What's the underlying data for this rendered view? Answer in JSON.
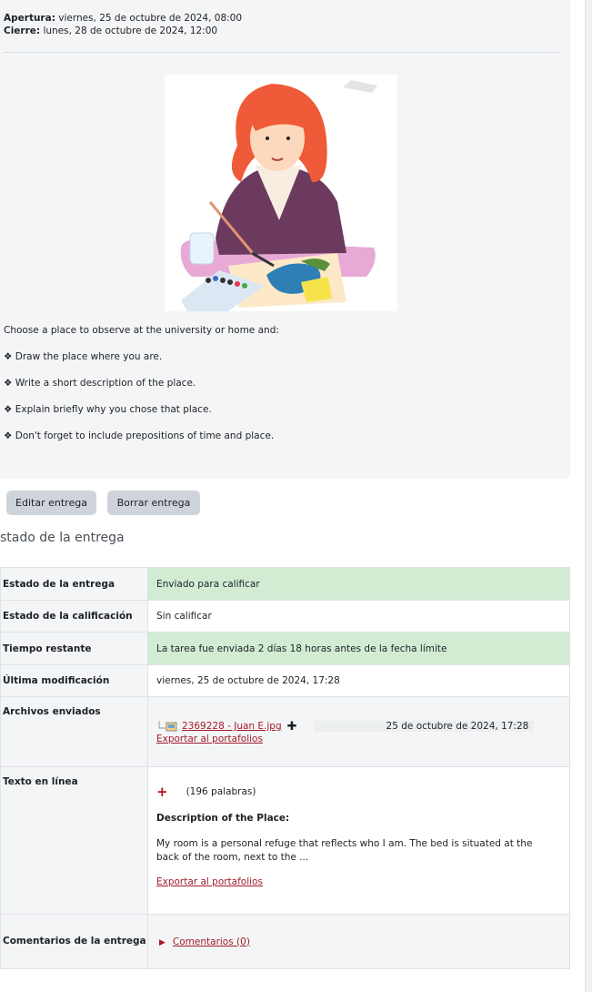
{
  "dates": {
    "opening_label": "Apertura:",
    "opening_value": "viernes, 25 de octubre de 2024, 08:00",
    "closing_label": "Cierre:",
    "closing_value": "lunes, 28 de octubre de 2024, 12:00"
  },
  "instructions": {
    "intro": "Choose a place to observe at the university or home and:",
    "items": [
      "❖ Draw the place where you are.",
      "❖ Write a short description of the place.",
      "❖ Explain briefly why you chose that place.",
      "❖ Don't forget to include prepositions of time and place."
    ]
  },
  "actions": {
    "edit_label": "Editar entrega",
    "delete_label": "Borrar entrega"
  },
  "submission": {
    "section_title": "stado de la entrega",
    "rows": {
      "status_label": "Estado de la entrega",
      "status_value": "Enviado para calificar",
      "grading_label": "Estado de la calificación",
      "grading_value": "Sin calificar",
      "time_label": "Tiempo restante",
      "time_value": "La tarea fue enviada 2 días 18 horas antes de la fecha límite",
      "modified_label": "Última modificación",
      "modified_value": "viernes, 25 de octubre de 2024, 17:28",
      "files_label": "Archivos enviados",
      "file_name": "2369228 - Juan E.jpg",
      "file_date": "25 de octubre de 2024, 17:28",
      "files_export": "Exportar al portafolios",
      "online_label": "Texto en línea",
      "word_count": "(196 palabras)",
      "online_heading": "Description of the Place:",
      "online_excerpt": "My room is a personal refuge that reflects who I am. The bed is situated at the back of the room, next to the ...",
      "online_export": "Exportar al portafolios",
      "comments_label": "Comentarios de la entrega",
      "comments_link": "Comentarios (0)"
    }
  },
  "colors": {
    "accent_link": "#a11d2a",
    "success_bg": "#d1ecd3",
    "button_bg": "#ced4da"
  }
}
